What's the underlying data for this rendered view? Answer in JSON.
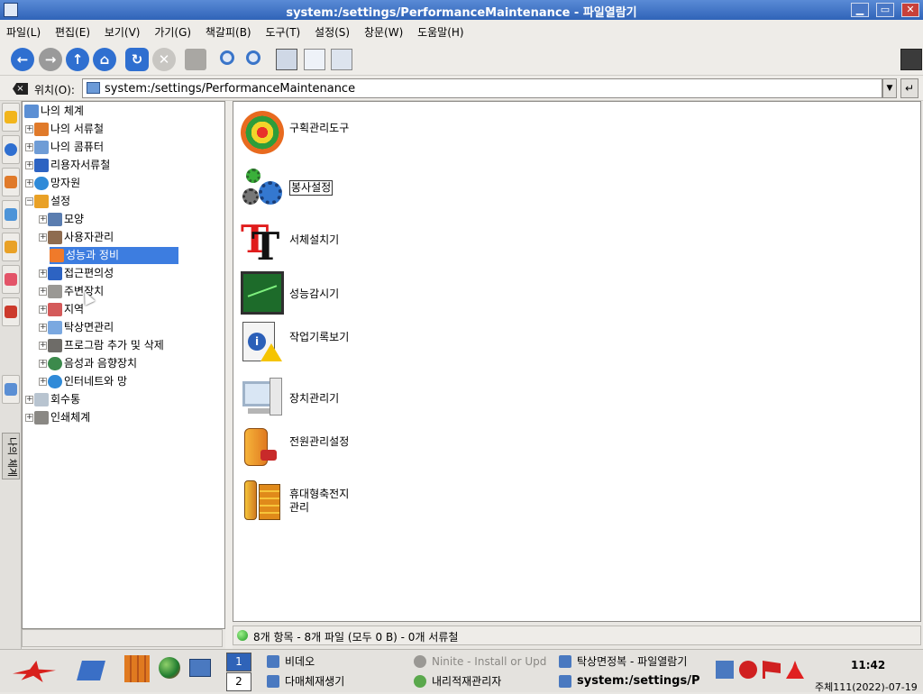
{
  "window": {
    "title": "system:/settings/PerformanceMaintenance - 파일열람기",
    "buttons": [
      "minimize",
      "maximize",
      "close"
    ]
  },
  "menu": {
    "items": [
      "파일(L)",
      "편집(E)",
      "보기(V)",
      "가기(G)",
      "책갈피(B)",
      "도구(T)",
      "설정(S)",
      "창문(W)",
      "도움말(H)"
    ]
  },
  "toolbar": {
    "buttons": [
      "back",
      "forward",
      "up",
      "home",
      "reload",
      "stop",
      "print",
      "zoom-in",
      "zoom-out",
      "icon-view",
      "detail-view",
      "preview"
    ]
  },
  "location": {
    "label": "위치(O):",
    "value": "system:/settings/PerformanceMaintenance"
  },
  "sidebar": {
    "vertical_tab_label": "나의 체계"
  },
  "tree": {
    "nodes": [
      {
        "label": "나의 체계",
        "expander": ""
      },
      {
        "label": "나의 서류철",
        "expander": "+"
      },
      {
        "label": "나의 콤퓨터",
        "expander": "+"
      },
      {
        "label": "리용자서류철",
        "expander": "+"
      },
      {
        "label": "망자원",
        "expander": "+"
      },
      {
        "label": "설정",
        "expander": "−"
      },
      {
        "label": "모양",
        "expander": "+"
      },
      {
        "label": "사용자관리",
        "expander": "+"
      },
      {
        "label": "성능과 정비",
        "expander": ""
      },
      {
        "label": "접근편의성",
        "expander": "+"
      },
      {
        "label": "주변장치",
        "expander": "+"
      },
      {
        "label": "지역",
        "expander": "+"
      },
      {
        "label": "탁상면관리",
        "expander": "+"
      },
      {
        "label": "프로그람 추가 및 삭제",
        "expander": "+"
      },
      {
        "label": "음성과 음향장치",
        "expander": "+"
      },
      {
        "label": "인터네트와 망",
        "expander": "+"
      },
      {
        "label": "회수통",
        "expander": "+"
      },
      {
        "label": "인쇄체계",
        "expander": "+"
      }
    ]
  },
  "content": {
    "items": [
      {
        "label": "구획관리도구"
      },
      {
        "label": "봉사설정"
      },
      {
        "label": "서체설치기"
      },
      {
        "label": "성능감시기"
      },
      {
        "label": "작업기록보기"
      },
      {
        "label": "장치관리기"
      },
      {
        "label": "전원관리설정"
      },
      {
        "label": "휴대형축전지",
        "label2": "관리"
      }
    ]
  },
  "status": {
    "text": "8개 항목 - 8개 파일 (모두 0 B) - 0개 서류철"
  },
  "taskbar": {
    "desktops": [
      "1",
      "2"
    ],
    "tasks": [
      {
        "label": "비데오"
      },
      {
        "label": "Ninite - Install or Upd"
      },
      {
        "label": "탁상면정복 - 파일열람기"
      },
      {
        "label": "다매체재생기"
      },
      {
        "label": "내리적재관리자"
      },
      {
        "label": "system:/settings/P"
      }
    ],
    "clock": "11:42",
    "date": "주체111(2022)-07-19"
  }
}
